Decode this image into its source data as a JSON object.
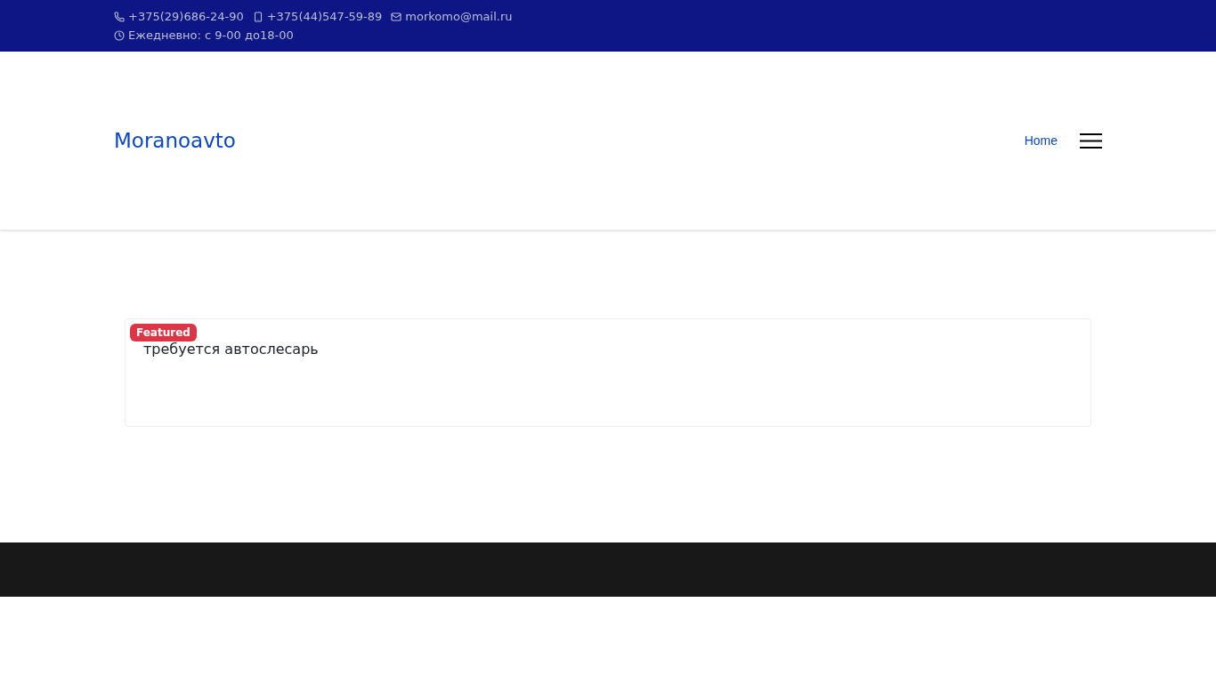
{
  "top_bar": {
    "contacts": [
      {
        "kind": "phone",
        "text": "+375(29)686-24-90"
      },
      {
        "kind": "mobile",
        "text": "+375(44)547-59-89"
      },
      {
        "kind": "email",
        "text": "morkomo@mail.ru"
      }
    ],
    "hours": {
      "kind": "clock",
      "text": "Ежедневно: с 9-00 до18-00"
    }
  },
  "header": {
    "logo": "Moranoavto",
    "nav": [
      {
        "label": "Home"
      }
    ]
  },
  "posts": [
    {
      "badge": "Featured",
      "title": "требуется автослесарь"
    }
  ]
}
